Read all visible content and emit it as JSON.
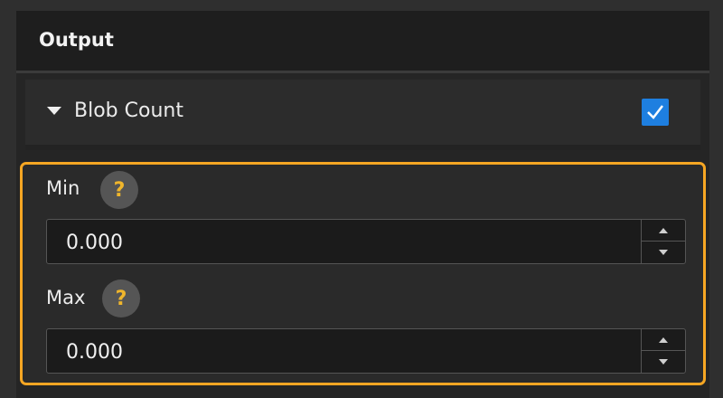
{
  "header": {
    "title": "Output"
  },
  "section": {
    "label": "Blob Count",
    "enabled": true
  },
  "fields": [
    {
      "label": "Min",
      "value": "0.000",
      "help": "?"
    },
    {
      "label": "Max",
      "value": "0.000",
      "help": "?"
    }
  ],
  "colors": {
    "accent": "#1e7fe0",
    "highlight": "#f5a623",
    "help_glyph": "#f0b62c"
  }
}
